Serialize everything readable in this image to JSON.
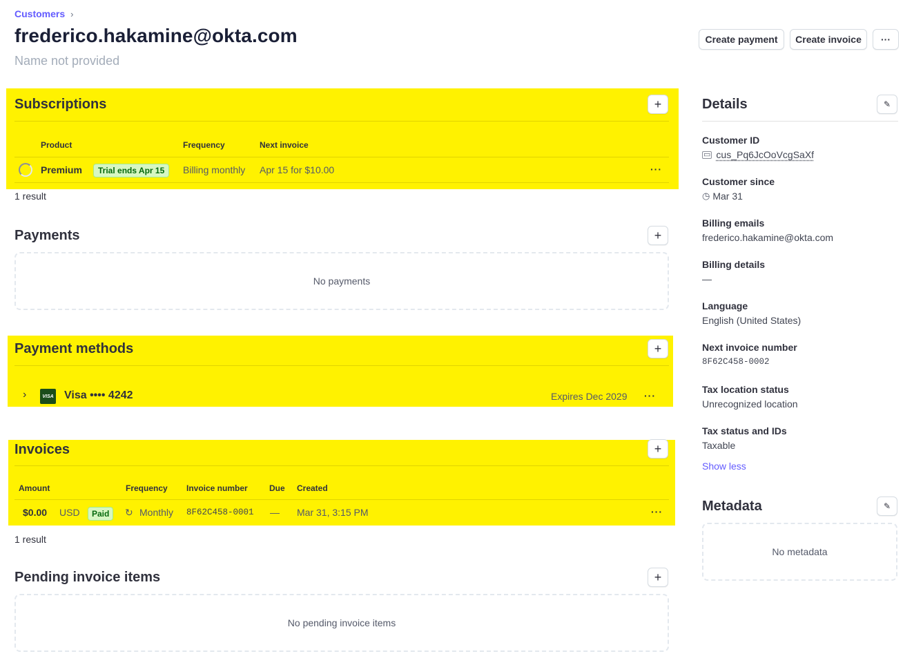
{
  "breadcrumb": {
    "label": "Customers"
  },
  "customer": {
    "email": "frederico.hakamine@okta.com",
    "name": "Name not provided"
  },
  "actions": {
    "create_payment": "Create payment",
    "create_invoice": "Create invoice",
    "more": "···"
  },
  "subscriptions": {
    "title": "Subscriptions",
    "columns": [
      "Product",
      "Frequency",
      "Next invoice"
    ],
    "row": {
      "product": "Premium",
      "badge": "Trial ends Apr 15",
      "frequency": "Billing monthly",
      "next_invoice": "Apr 15 for $10.00"
    },
    "result_count": "1 result"
  },
  "payments": {
    "title": "Payments",
    "empty": "No payments"
  },
  "payment_methods": {
    "title": "Payment methods",
    "card": {
      "brand_logo": "VISA",
      "label": "Visa •••• 4242",
      "expires": "Expires Dec 2029"
    }
  },
  "invoices": {
    "title": "Invoices",
    "columns": [
      "Amount",
      "Frequency",
      "Invoice number",
      "Due",
      "Created"
    ],
    "row": {
      "amount": "$0.00",
      "currency": "USD",
      "status": "Paid",
      "frequency": "Monthly",
      "number": "8F62C458-0001",
      "due": "—",
      "created": "Mar 31, 3:15 PM"
    },
    "result_count": "1 result"
  },
  "pending_items": {
    "title": "Pending invoice items",
    "empty": "No pending invoice items"
  },
  "details": {
    "title": "Details",
    "fields": [
      {
        "label": "Customer ID",
        "value": "cus_Pq6JcOoVcgSaXf"
      },
      {
        "label": "Customer since",
        "value": "Mar 31"
      },
      {
        "label": "Billing emails",
        "value": "frederico.hakamine@okta.com"
      },
      {
        "label": "Billing details",
        "value": "—"
      },
      {
        "label": "Language",
        "value": "English (United States)"
      },
      {
        "label": "Next invoice number",
        "value": "8F62C458-0002"
      },
      {
        "label": "Tax location status",
        "value": "Unrecognized location"
      },
      {
        "label": "Tax status and IDs",
        "value": "Taxable"
      }
    ],
    "show_less": "Show less"
  },
  "metadata": {
    "title": "Metadata",
    "empty": "No metadata"
  },
  "colors": {
    "accent": "#635bff",
    "highlight": "#fff200",
    "badge_bg": "#d7f7c2",
    "badge_text": "#05690d"
  }
}
